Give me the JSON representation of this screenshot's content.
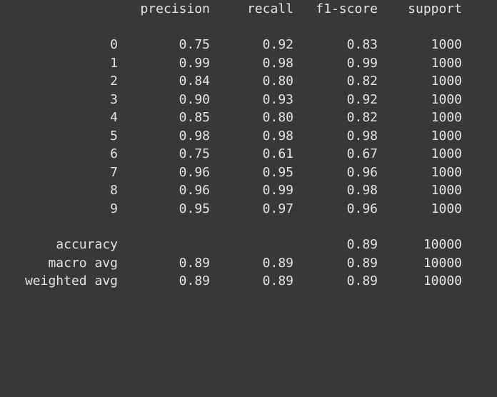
{
  "report": {
    "headers": {
      "precision": "precision",
      "recall": "recall",
      "f1": "f1-score",
      "support": "support"
    },
    "class_rows": [
      {
        "label": "0",
        "precision": "0.75",
        "recall": "0.92",
        "f1": "0.83",
        "support": "1000"
      },
      {
        "label": "1",
        "precision": "0.99",
        "recall": "0.98",
        "f1": "0.99",
        "support": "1000"
      },
      {
        "label": "2",
        "precision": "0.84",
        "recall": "0.80",
        "f1": "0.82",
        "support": "1000"
      },
      {
        "label": "3",
        "precision": "0.90",
        "recall": "0.93",
        "f1": "0.92",
        "support": "1000"
      },
      {
        "label": "4",
        "precision": "0.85",
        "recall": "0.80",
        "f1": "0.82",
        "support": "1000"
      },
      {
        "label": "5",
        "precision": "0.98",
        "recall": "0.98",
        "f1": "0.98",
        "support": "1000"
      },
      {
        "label": "6",
        "precision": "0.75",
        "recall": "0.61",
        "f1": "0.67",
        "support": "1000"
      },
      {
        "label": "7",
        "precision": "0.96",
        "recall": "0.95",
        "f1": "0.96",
        "support": "1000"
      },
      {
        "label": "8",
        "precision": "0.96",
        "recall": "0.99",
        "f1": "0.98",
        "support": "1000"
      },
      {
        "label": "9",
        "precision": "0.95",
        "recall": "0.97",
        "f1": "0.96",
        "support": "1000"
      }
    ],
    "summary_rows": [
      {
        "label": "accuracy",
        "precision": "",
        "recall": "",
        "f1": "0.89",
        "support": "10000"
      },
      {
        "label": "macro avg",
        "precision": "0.89",
        "recall": "0.89",
        "f1": "0.89",
        "support": "10000"
      },
      {
        "label": "weighted avg",
        "precision": "0.89",
        "recall": "0.89",
        "f1": "0.89",
        "support": "10000"
      }
    ],
    "colors": {
      "background": "#383838",
      "text": "#e3e3e3"
    }
  }
}
